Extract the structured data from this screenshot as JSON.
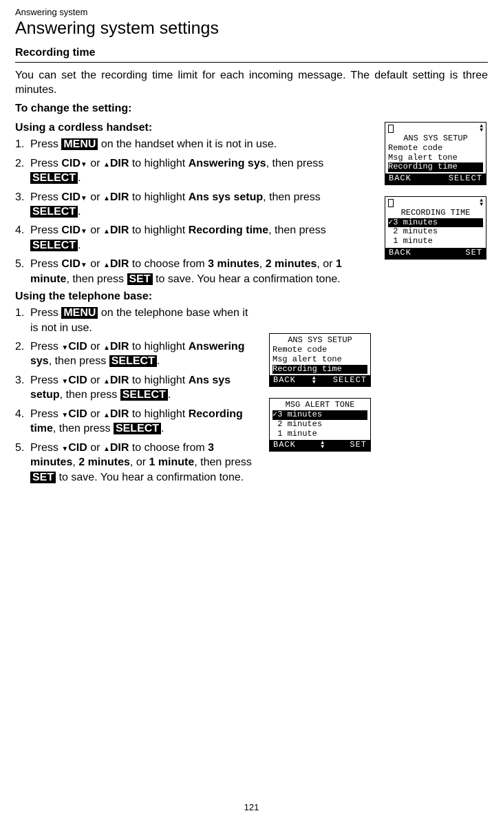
{
  "breadcrumb": "Answering system",
  "page_title": "Answering system settings",
  "section": {
    "heading": "Recording time",
    "intro": "You can set the recording time limit for each incoming message. The default setting is three minutes.",
    "to_change": "To change the setting:",
    "handset_heading": "Using a cordless handset:",
    "base_heading": "Using the telephone base:"
  },
  "labels": {
    "menu": "MENU",
    "select": "SELECT",
    "set": "SET",
    "cid": "CID",
    "dir": "DIR",
    "answering_sys": "Answering sys",
    "ans_sys_setup": "Ans sys setup",
    "recording_time": "Recording time",
    "three_min": "3 minutes",
    "two_min": "2 minutes",
    "one_min": "1 minute"
  },
  "handset_steps": {
    "s1_a": "Press ",
    "s1_b": " on the handset when it is not in use.",
    "s2_a": "Press ",
    "s2_b": " or ",
    "s2_c": " to highlight ",
    "s2_d": ", then press ",
    "s2_e": ".",
    "s5_a": " to choose from ",
    "s5_b": ", ",
    "s5_c": ", or ",
    "s5_d": ", then press ",
    "s5_e": " to save. You hear a confirmation tone."
  },
  "base_steps": {
    "s1_b": " on the telephone base when it is not in use."
  },
  "screens": {
    "handset_setup": {
      "title": "ANS SYS SETUP",
      "l1": "Remote code",
      "l2": "Msg alert tone",
      "l3": "Recording time",
      "left": "BACK",
      "right": "SELECT"
    },
    "handset_recording": {
      "title": "RECORDING TIME",
      "l1": "3 minutes",
      "l2": "2 minutes",
      "l3": "1 minute",
      "left": "BACK",
      "right": "SET"
    },
    "base_setup": {
      "title": "ANS SYS SETUP",
      "l1": "Remote code",
      "l2": "Msg alert tone",
      "l3": "Recording time",
      "left": "BACK",
      "right": "SELECT"
    },
    "base_msgalert": {
      "title": "MSG ALERT TONE",
      "l1": "3 minutes",
      "l2": "2 minutes",
      "l3": "1 minute",
      "left": "BACK",
      "right": "SET"
    }
  },
  "page_number": "121"
}
